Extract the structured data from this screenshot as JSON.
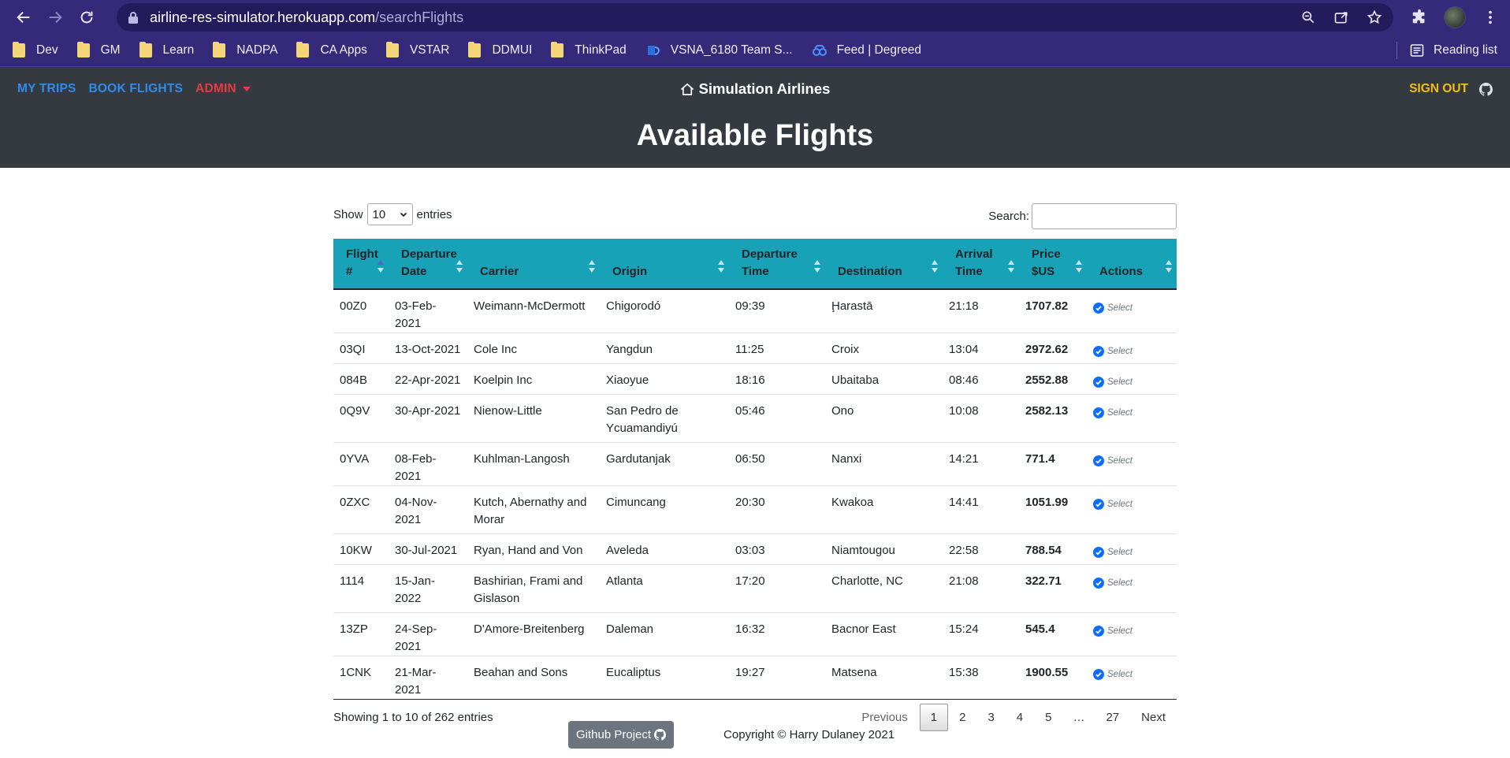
{
  "browser": {
    "url_host": "airline-res-simulator.herokuapp.com",
    "url_path": "/searchFlights",
    "bookmarks": [
      "Dev",
      "GM",
      "Learn",
      "NADPA",
      "CA Apps",
      "VSTAR",
      "DDMUI",
      "ThinkPad"
    ],
    "bookmark_teams": "VSNA_6180 Team S...",
    "bookmark_degreed": "Feed | Degreed",
    "reading_list": "Reading list"
  },
  "nav": {
    "my_trips": "MY TRIPS",
    "book_flights": "BOOK FLIGHTS",
    "admin": "ADMIN",
    "brand": "Simulation Airlines",
    "sign_out": "SIGN OUT"
  },
  "page": {
    "title": "Available Flights"
  },
  "table_controls": {
    "show_label": "Show",
    "entries_per_page": "10",
    "entries_label": "entries",
    "search_label": "Search:",
    "search_value": ""
  },
  "table": {
    "headers": [
      "Flight #",
      "Departure Date",
      "Carrier",
      "Origin",
      "Departure Time",
      "Destination",
      "Arrival Time",
      "Price $US",
      "Actions"
    ],
    "action_label": "Select",
    "rows": [
      [
        "00Z0",
        "03-Feb-2021",
        "Weimann-McDermott",
        "Chigorodó",
        "09:39",
        "Ḩarastā",
        "21:18",
        "1707.82"
      ],
      [
        "03QI",
        "13-Oct-2021",
        "Cole Inc",
        "Yangdun",
        "11:25",
        "Croix",
        "13:04",
        "2972.62"
      ],
      [
        "084B",
        "22-Apr-2021",
        "Koelpin Inc",
        "Xiaoyue",
        "18:16",
        "Ubaitaba",
        "08:46",
        "2552.88"
      ],
      [
        "0Q9V",
        "30-Apr-2021",
        "Nienow-Little",
        "San Pedro de Ycuamandiyú",
        "05:46",
        "Ono",
        "10:08",
        "2582.13"
      ],
      [
        "0YVA",
        "08-Feb-2021",
        "Kuhlman-Langosh",
        "Gardutanjak",
        "06:50",
        "Nanxi",
        "14:21",
        "771.4"
      ],
      [
        "0ZXC",
        "04-Nov-2021",
        "Kutch, Abernathy and Morar",
        "Cimuncang",
        "20:30",
        "Kwakoa",
        "14:41",
        "1051.99"
      ],
      [
        "10KW",
        "30-Jul-2021",
        "Ryan, Hand and Von",
        "Aveleda",
        "03:03",
        "Niamtougou",
        "22:58",
        "788.54"
      ],
      [
        "1114",
        "15-Jan-2022",
        "Bashirian, Frami and Gislason",
        "Atlanta",
        "17:20",
        "Charlotte, NC",
        "21:08",
        "322.71"
      ],
      [
        "13ZP",
        "24-Sep-2021",
        "D'Amore-Breitenberg",
        "Daleman",
        "16:32",
        "Bacnor East",
        "15:24",
        "545.4"
      ],
      [
        "1CNK",
        "21-Mar-2021",
        "Beahan and Sons",
        "Eucaliptus",
        "19:27",
        "Matsena",
        "15:38",
        "1900.55"
      ]
    ]
  },
  "pagination": {
    "info": "Showing 1 to 10 of 262 entries",
    "previous": "Previous",
    "pages": [
      "1",
      "2",
      "3",
      "4",
      "5"
    ],
    "ellipsis": "…",
    "last": "27",
    "next": "Next",
    "current": "1"
  },
  "footer": {
    "github_button": "Github Project",
    "copyright": "Copyright © Harry Dulaney 2021"
  },
  "colors": {
    "browser_bg": "#35297a",
    "header_bg": "#343a40",
    "table_head": "#17a2b8",
    "nav_blue": "#2e8cf0",
    "nav_red": "#e53b45",
    "nav_yellow": "#f5bf0f"
  }
}
